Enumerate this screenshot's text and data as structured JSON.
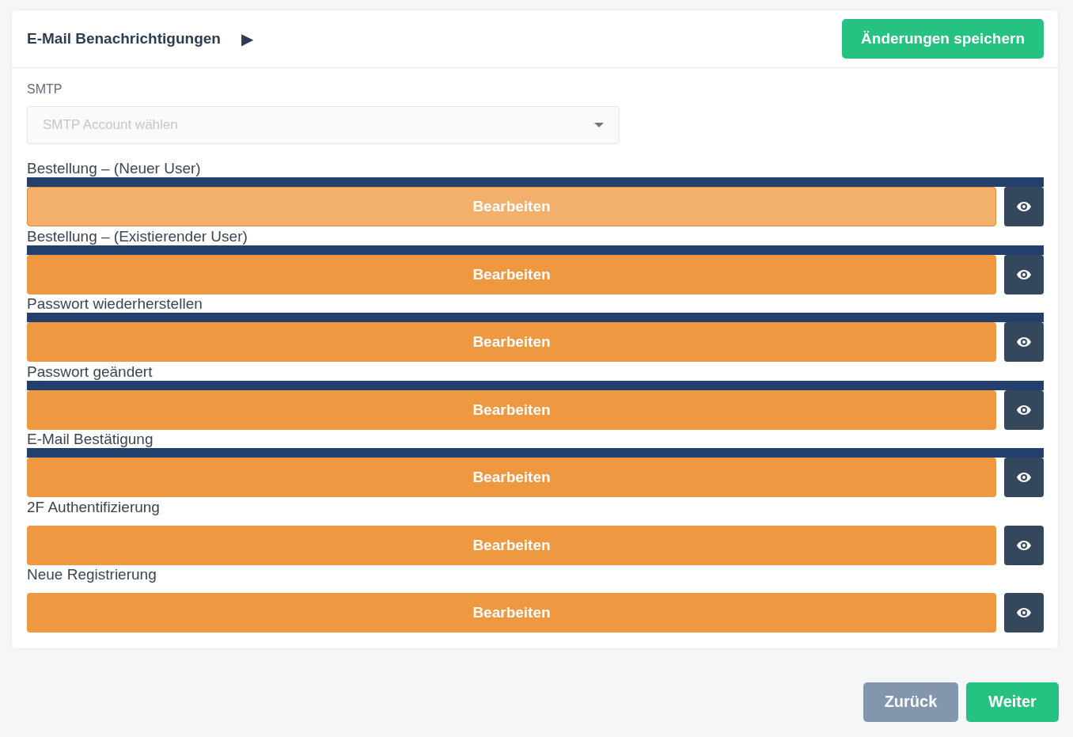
{
  "card": {
    "title": "E-Mail Benachrichtigungen",
    "title_icon": "▶",
    "save_button": "Änderungen speichern"
  },
  "smtp": {
    "label": "SMTP",
    "placeholder": "SMTP Account wählen"
  },
  "templates": [
    {
      "label": "Bestellung – (Neuer User)",
      "bar": true,
      "hovered": true,
      "button": "Bearbeiten"
    },
    {
      "label": "Bestellung – (Existierender User)",
      "bar": true,
      "hovered": false,
      "button": "Bearbeiten"
    },
    {
      "label": "Passwort wiederherstellen",
      "bar": true,
      "hovered": false,
      "button": "Bearbeiten"
    },
    {
      "label": "Passwort geändert",
      "bar": true,
      "hovered": false,
      "button": "Bearbeiten"
    },
    {
      "label": "E-Mail Bestätigung",
      "bar": true,
      "hovered": false,
      "button": "Bearbeiten"
    },
    {
      "label": "2F Authentifizierung",
      "bar": false,
      "hovered": false,
      "button": "Bearbeiten"
    },
    {
      "label": "Neue Registrierung",
      "bar": false,
      "hovered": false,
      "button": "Bearbeiten"
    }
  ],
  "footer": {
    "back": "Zurück",
    "next": "Weiter"
  }
}
